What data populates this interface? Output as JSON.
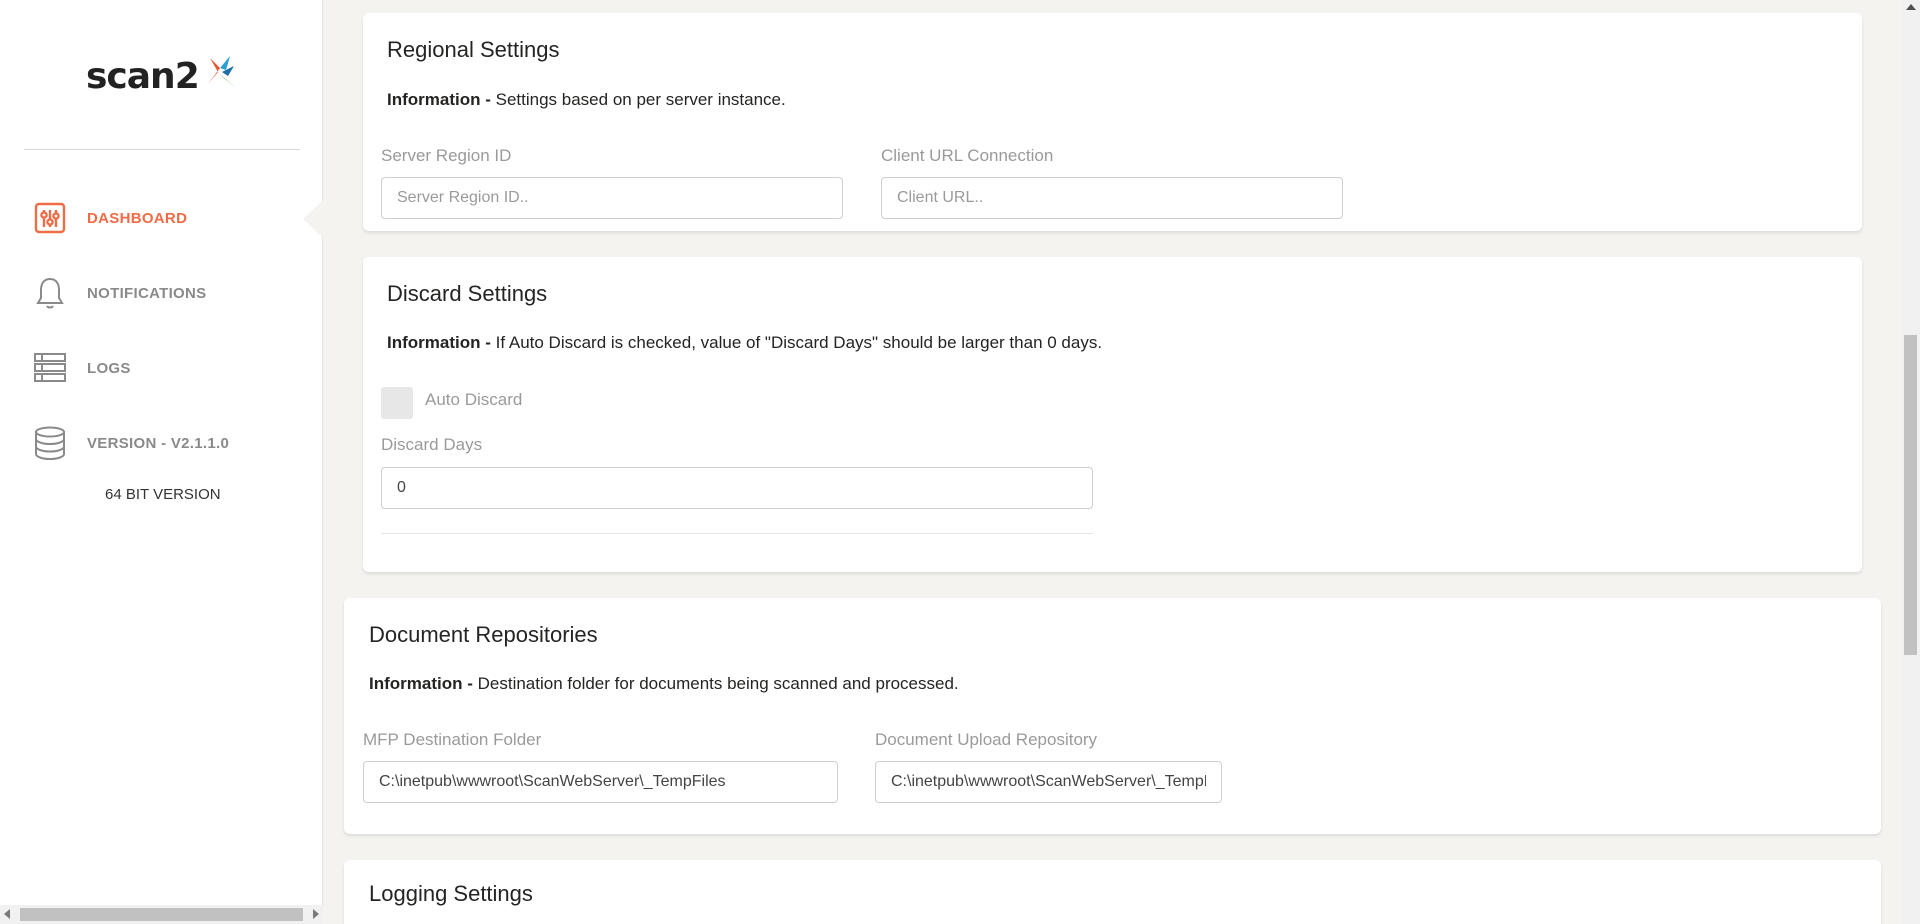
{
  "sidebar": {
    "logo_text": "scan2",
    "nav": [
      {
        "label": "DASHBOARD",
        "icon": "sliders-icon",
        "active": true
      },
      {
        "label": "NOTIFICATIONS",
        "icon": "bell-icon",
        "active": false
      },
      {
        "label": "LOGS",
        "icon": "list-icon",
        "active": false
      },
      {
        "label": "VERSION - V2.1.1.0",
        "icon": "database-icon",
        "active": false
      }
    ],
    "version_sub": "64 BIT VERSION"
  },
  "regional": {
    "title": "Regional Settings",
    "info_bold": "Information -",
    "info_text": "Settings based on per server instance.",
    "server_region_label": "Server Region ID",
    "server_region_placeholder": "Server Region ID..",
    "client_url_label": "Client URL Connection",
    "client_url_placeholder": "Client URL.."
  },
  "discard": {
    "title": "Discard Settings",
    "info_bold": "Information -",
    "info_text": "If Auto Discard is checked, value of \"Discard Days\" should be larger than 0 days.",
    "auto_discard_label": "Auto Discard",
    "auto_discard_checked": false,
    "discard_days_label": "Discard Days",
    "discard_days_value": "0"
  },
  "repositories": {
    "title": "Document Repositories",
    "info_bold": "Information -",
    "info_text": "Destination folder for documents being scanned and processed.",
    "mfp_label": "MFP Destination Folder",
    "mfp_value": "C:\\inetpub\\wwwroot\\ScanWebServer\\_TempFiles",
    "upload_label": "Document Upload Repository",
    "upload_value": "C:\\inetpub\\wwwroot\\ScanWebServer\\_TempFiles"
  },
  "logging": {
    "title": "Logging Settings"
  },
  "colors": {
    "accent": "#ef6c47",
    "background": "#f4f3ef",
    "muted": "#8a8a8a"
  }
}
